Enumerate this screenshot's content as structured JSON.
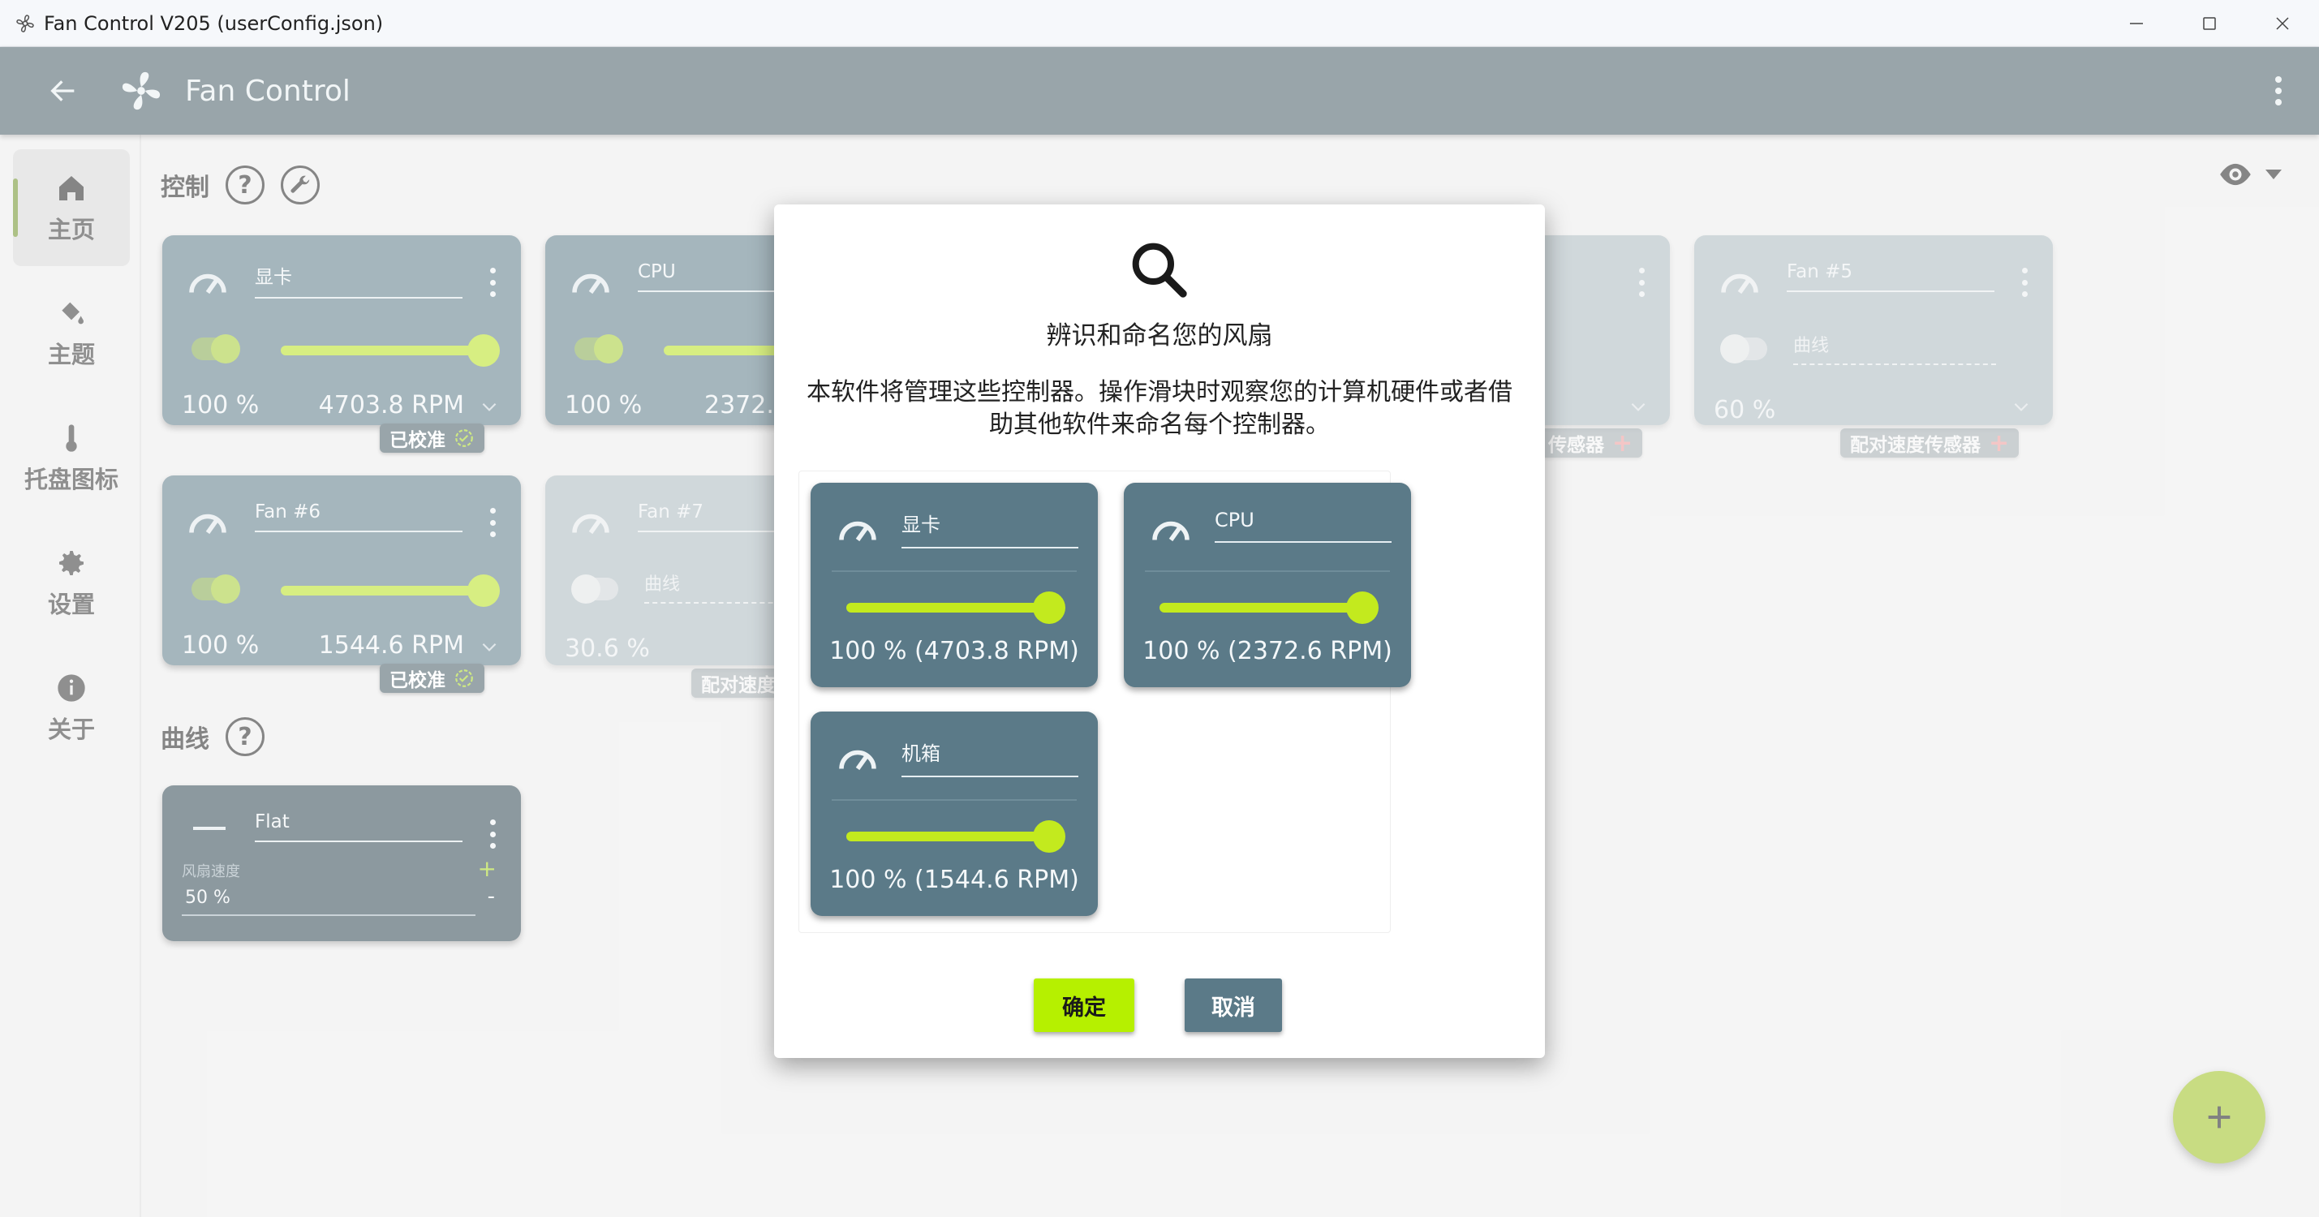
{
  "window": {
    "title": "Fan Control V205 (userConfig.json)"
  },
  "appbar": {
    "title": "Fan Control"
  },
  "sidebar": {
    "items": [
      {
        "label": "主页",
        "icon": "home-icon",
        "active": true
      },
      {
        "label": "主题",
        "icon": "paint-bucket-icon"
      },
      {
        "label": "托盘图标",
        "icon": "thermometer-icon"
      },
      {
        "label": "设置",
        "icon": "gear-icon"
      },
      {
        "label": "关于",
        "icon": "info-icon"
      }
    ]
  },
  "sections": {
    "controls_label": "控制",
    "curves_label": "曲线"
  },
  "controls": [
    {
      "name": "显卡",
      "percent": "100 %",
      "rpm": "4703.8 RPM",
      "badge": "已校准",
      "enabled": true
    },
    {
      "name": "CPU",
      "percent": "100 %",
      "rpm": "2372.",
      "badge": "",
      "enabled": true
    },
    {
      "name": "Fan #5",
      "percent": "60 %",
      "select": "曲线",
      "badge": "配对速度传感器",
      "enabled": false
    },
    {
      "name": "Fan #6",
      "percent": "100 %",
      "rpm": "1544.6 RPM",
      "badge": "已校准",
      "enabled": true
    },
    {
      "name": "Fan #7",
      "percent": "30.6 %",
      "select": "曲线",
      "badge": "配对速度",
      "enabled": false
    },
    {
      "name": "",
      "badge": "传感器",
      "enabled": false
    }
  ],
  "curves": [
    {
      "name": "Flat",
      "speed_label": "风扇速度",
      "value": "50 %",
      "plus": "+",
      "minus": "-"
    }
  ],
  "dialog": {
    "title": "辨识和命名您的风扇",
    "description": "本软件将管理这些控制器。操作滑块时观察您的计算机硬件或者借助其他软件来命名每个控制器。",
    "cards": [
      {
        "name": "显卡",
        "value": "100 %  (4703.8 RPM)",
        "level": 1.0
      },
      {
        "name": "CPU",
        "value": "100 %  (2372.6 RPM)",
        "level": 1.0
      },
      {
        "name": "机箱",
        "value": "100 %  (1544.6 RPM)",
        "level": 1.0
      }
    ],
    "ok_label": "确定",
    "cancel_label": "取消"
  },
  "colors": {
    "accent": "#b6f000",
    "card": "#5b7a88",
    "appbar": "#465b64"
  }
}
